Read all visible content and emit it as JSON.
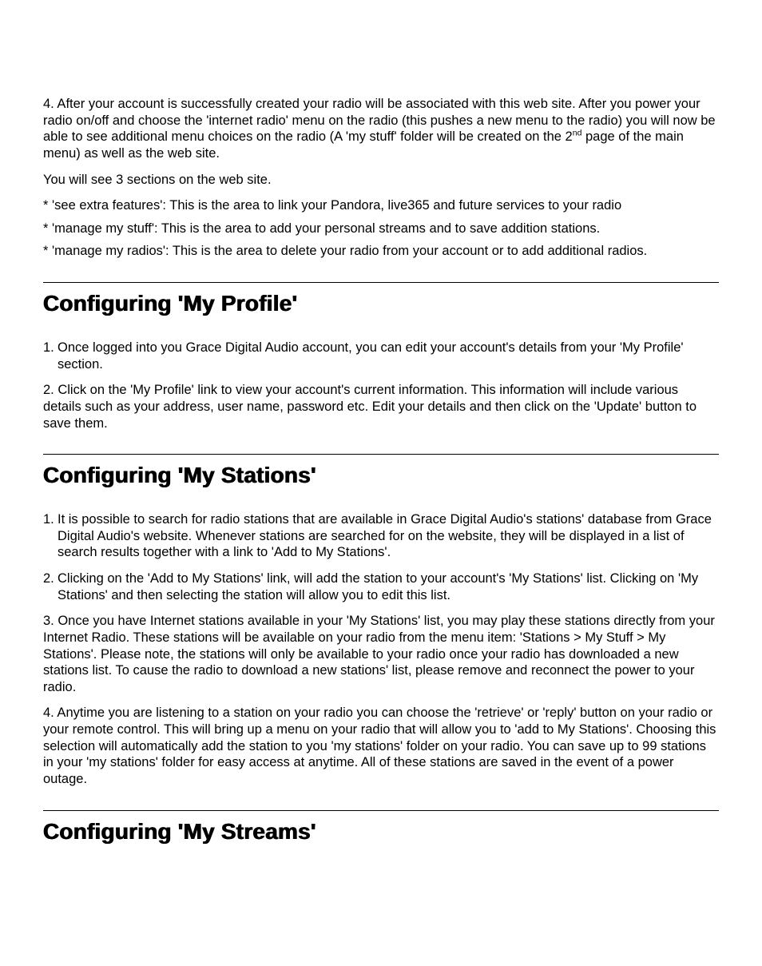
{
  "intro": {
    "p4_a": "4.  After your account is successfully created your radio will be associated with this web site.  After you power your radio on/off and choose the 'internet radio' menu on the radio (this pushes a new menu to the radio) you will now be able to see additional menu choices on the radio (A 'my stuff' folder will be created on the 2",
    "p4_sup": "nd",
    "p4_b": " page of the main menu) as well as the web site.",
    "p5": "You will see 3 sections on the web site.",
    "b1": "* 'see extra features':  This is the area to link your Pandora, live365 and future services to your radio",
    "b2": "* 'manage my stuff':    This is the area to add your personal streams and to save addition stations.",
    "b3": "* 'manage my radios':  This is the area to delete your radio from your account or to add additional radios."
  },
  "profile": {
    "heading": "Configuring 'My Profile'",
    "p1": "1. Once logged into you Grace Digital Audio account, you can edit your account's details from your 'My Profile' section.",
    "p2": "2. Click on the 'My Profile' link to view your account's current information. This information will include various details such as your address, user name, password etc. Edit your details and then click on the 'Update' button to save them."
  },
  "stations": {
    "heading": "Configuring 'My Stations'",
    "p1": "1. It is possible to search for radio stations that are available in Grace Digital Audio's stations' database from Grace Digital Audio's website. Whenever stations are searched for on the website, they will be displayed in a list of search results together with a link to 'Add to My Stations'.",
    "p2": "2. Clicking on the 'Add to My Stations' link, will add the station to your account's 'My Stations' list. Clicking on 'My Stations' and then selecting the station will allow you to edit this list.",
    "p3": "3. Once you have Internet stations available in your 'My Stations' list, you may play these stations directly from your Internet Radio. These stations will be available on your radio from the menu item: 'Stations > My Stuff > My Stations'. Please note, the stations will only be available to your radio once your radio has downloaded a new stations list. To cause the radio to download a new stations' list, please remove and reconnect the power to your radio.",
    "p4": "4. Anytime you are listening to a station on your radio you can choose the 'retrieve' or 'reply' button on your radio or your remote control. This will bring up a menu on your radio that will allow you to 'add to My Stations'. Choosing this selection will automatically add the station to you 'my stations' folder on your radio. You can save up to 99 stations in your 'my stations' folder for easy access at anytime. All of these stations are saved in the event of a power outage."
  },
  "streams": {
    "heading": "Configuring 'My Streams'"
  }
}
